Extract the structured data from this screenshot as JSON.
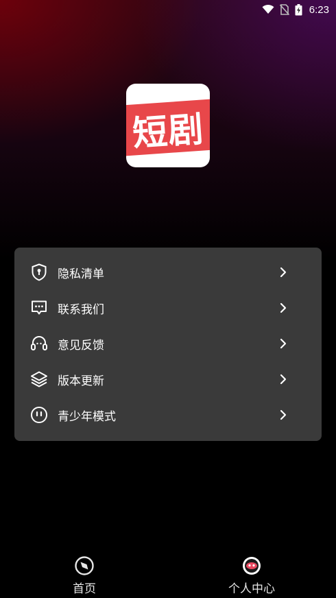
{
  "status_bar": {
    "time": "6:23",
    "icons": [
      "wifi-icon",
      "no-sim-icon",
      "battery-charging-icon"
    ]
  },
  "app": {
    "logo_text": "短剧",
    "logo_colors": {
      "background": "#ffffff",
      "band": "#e8474a"
    }
  },
  "menu": {
    "items": [
      {
        "label": "隐私清单",
        "icon": "shield-icon"
      },
      {
        "label": "联系我们",
        "icon": "chat-icon"
      },
      {
        "label": "意见反馈",
        "icon": "headset-icon"
      },
      {
        "label": "版本更新",
        "icon": "layers-icon"
      },
      {
        "label": "青少年模式",
        "icon": "face-icon"
      }
    ]
  },
  "bottom_nav": {
    "tabs": [
      {
        "label": "首页",
        "icon": "compass-icon",
        "active": false
      },
      {
        "label": "个人中心",
        "icon": "profile-icon",
        "active": true
      }
    ],
    "active_color": "#e8475e"
  }
}
